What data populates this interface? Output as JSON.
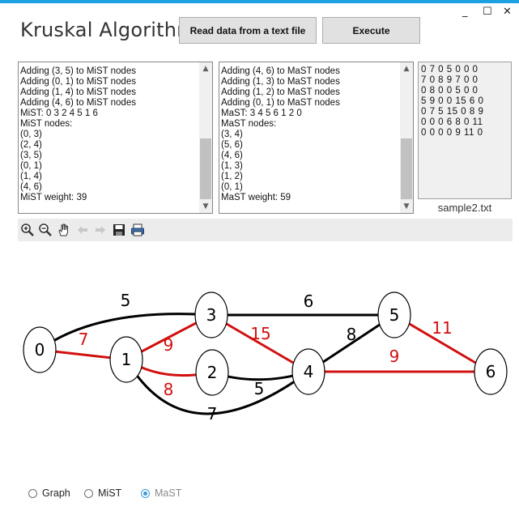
{
  "window": {
    "title": "Kruskal Algorithm",
    "controls": [
      "_",
      "☐",
      "✕"
    ]
  },
  "toolbar_buttons": {
    "read_label": "Read data from a text file",
    "execute_label": "Execute"
  },
  "mist_log": {
    "lines": [
      "Adding (3, 5) to MiST nodes",
      "Adding (0, 1) to MiST nodes",
      "Adding (1, 4) to MiST nodes",
      "Adding (4, 6) to MiST nodes",
      "MiST: 0 3 2 4 5 1 6",
      "MiST nodes:",
      "(0, 3)",
      "(2, 4)",
      "(3, 5)",
      "(0, 1)",
      "(1, 4)",
      "(4, 6)",
      "MiST weight: 39"
    ],
    "scroll_fraction": 0.86
  },
  "mast_log": {
    "lines": [
      "Adding (4, 6) to MaST nodes",
      "Adding (1, 3) to MaST nodes",
      "Adding (1, 2) to MaST nodes",
      "Adding (0, 1) to MaST nodes",
      "MaST: 3 4 5 6 1 2 0",
      "MaST nodes:",
      "(3, 4)",
      "(5, 6)",
      "(4, 6)",
      "(1, 3)",
      "(1, 2)",
      "(0, 1)",
      "MaST weight: 59"
    ],
    "scroll_fraction": 0.86
  },
  "matrix": {
    "rows": [
      "0 7 0 5 0 0 0",
      "7 0 8 9 7 0 0",
      "0 8 0 0 5 0 0",
      "5 9 0 0 15 6 0",
      "0 7 5 15 0 8 9",
      "0 0 0 6 8 0 11",
      "0 0 0 0 9 11 0"
    ],
    "filename": "sample2.txt"
  },
  "chart_toolbar": {
    "icons": [
      "zoom-in-icon",
      "zoom-out-icon",
      "pan-hand-icon",
      "back-arrow-icon",
      "forward-arrow-icon",
      "save-icon",
      "print-icon"
    ]
  },
  "graph": {
    "nodes": [
      {
        "id": "0"
      },
      {
        "id": "1"
      },
      {
        "id": "2"
      },
      {
        "id": "3"
      },
      {
        "id": "4"
      },
      {
        "id": "5"
      },
      {
        "id": "6"
      }
    ],
    "edges": [
      {
        "u": "0",
        "v": "3",
        "w": "5",
        "highlight": false
      },
      {
        "u": "0",
        "v": "1",
        "w": "7",
        "highlight": true
      },
      {
        "u": "1",
        "v": "3",
        "w": "9",
        "highlight": true
      },
      {
        "u": "1",
        "v": "2",
        "w": "8",
        "highlight": true
      },
      {
        "u": "1",
        "v": "4",
        "w": "7",
        "highlight": false
      },
      {
        "u": "2",
        "v": "4",
        "w": "5",
        "highlight": false
      },
      {
        "u": "3",
        "v": "5",
        "w": "6",
        "highlight": false
      },
      {
        "u": "3",
        "v": "4",
        "w": "15",
        "highlight": true
      },
      {
        "u": "4",
        "v": "5",
        "w": "8",
        "highlight": false
      },
      {
        "u": "4",
        "v": "6",
        "w": "9",
        "highlight": true
      },
      {
        "u": "5",
        "v": "6",
        "w": "11",
        "highlight": true
      }
    ],
    "colors": {
      "normal": "#000000",
      "highlight": "#d11010",
      "node_fill": "#ffffff"
    }
  },
  "view_options": {
    "graph_label": "Graph",
    "mist_label": "MiST",
    "mast_label": "MaST",
    "selected": "MaST"
  }
}
